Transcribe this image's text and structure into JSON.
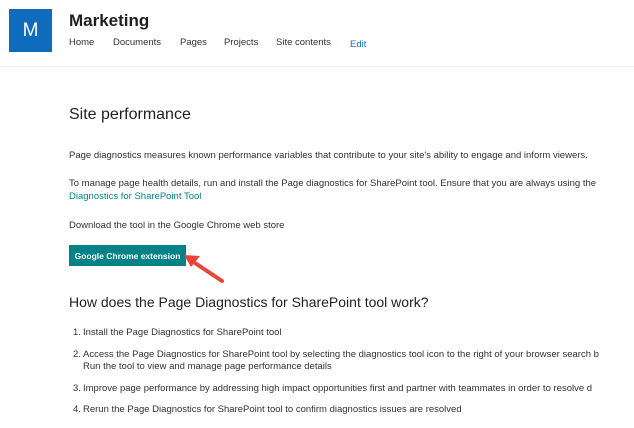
{
  "site": {
    "logo_letter": "M",
    "title": "Marketing",
    "nav": [
      "Home",
      "Documents",
      "Pages",
      "Projects",
      "Site contents"
    ],
    "edit_label": "Edit"
  },
  "main": {
    "title": "Site performance",
    "intro": "Page diagnostics measures known performance variables that contribute to your site's ability to engage and inform viewers.",
    "manage_line1": "To manage page health details, run and install the Page diagnostics for SharePoint tool. Ensure that you are always using the",
    "manage_link": "Diagnostics for SharePoint Tool",
    "download_text": "Download the tool in the Google Chrome web store",
    "cta_label": "Google Chrome extension",
    "how_title": "How does the Page Diagnostics for SharePoint tool work?",
    "steps": [
      {
        "num": "1.",
        "line1": "Install the Page Diagnostics for SharePoint tool",
        "line2": ""
      },
      {
        "num": "2.",
        "line1": "Access the Page Diagnostics for SharePoint tool by selecting the diagnostics tool icon to the right of your browser search b",
        "line2": "Run the tool to view and manage page performance details"
      },
      {
        "num": "3.",
        "line1": "Improve page performance by addressing high impact opportunities first and partner with teammates in order to resolve d",
        "line2": ""
      },
      {
        "num": "4.",
        "line1": "Rerun the Page Diagnostics for SharePoint tool to confirm diagnostics issues are resolved",
        "line2": ""
      }
    ]
  },
  "colors": {
    "logo_bg": "#0f6cbd",
    "accent": "#038387",
    "annotation_arrow": "#e8443a"
  }
}
